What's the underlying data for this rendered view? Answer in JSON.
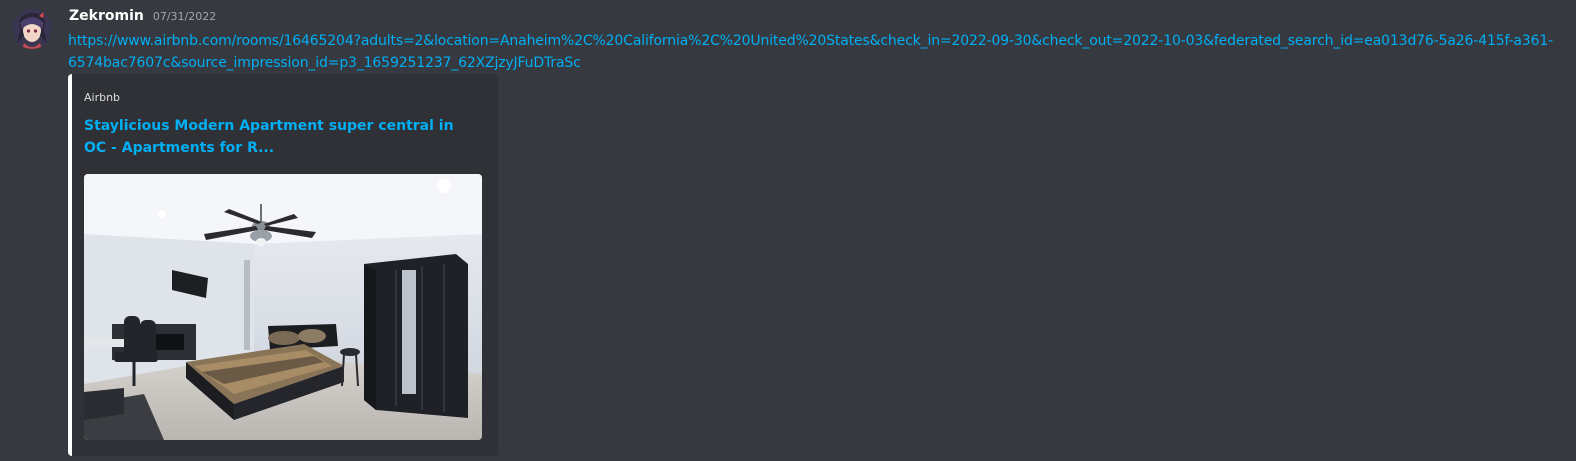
{
  "message": {
    "author": "Zekromin",
    "timestamp": "07/31/2022",
    "link_text": "https://www.airbnb.com/rooms/16465204?adults=2&location=Anaheim%2C%20California%2C%20United%20States&check_in=2022-09-30&check_out=2022-10-03&federated_search_id=ea013d76-5a26-415f-a361-6574bac7607c&source_impression_id=p3_1659251237_62XZjzyJFuDTraSc"
  },
  "embed": {
    "provider": "Airbnb",
    "title": "Staylicious Modern Apartment super central in OC - Apartments for R...",
    "image_icon": "bedroom-photo"
  },
  "colors": {
    "background": "#36393f",
    "embed_background": "#2f3136",
    "link": "#00aff4",
    "embed_border": "#ffffff",
    "username": "#ffffff",
    "timestamp": "#a3a6aa"
  }
}
